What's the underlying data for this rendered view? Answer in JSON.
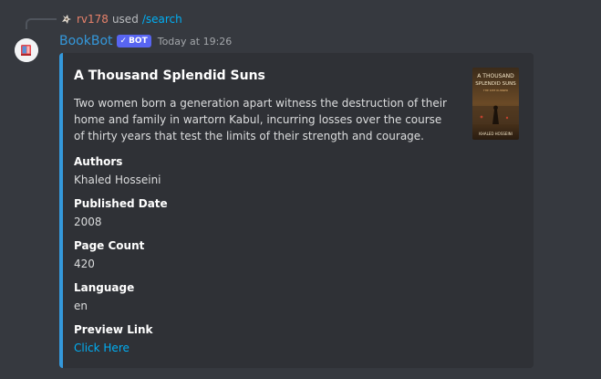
{
  "reply": {
    "username": "rv178",
    "used_text": "used",
    "command": "/search"
  },
  "author": {
    "name": "BookBot",
    "bot_tag": "BOT",
    "timestamp": "Today at 19:26"
  },
  "embed": {
    "accent_color": "#3498db",
    "title": "A Thousand Splendid Suns",
    "description": "Two women born a generation apart witness the destruction of their home and family in wartorn Kabul, incurring losses over the course of thirty years that test the limits of their strength and courage.",
    "thumbnail": {
      "title_line1": "A THOUSAND",
      "title_line2": "SPLENDID SUNS",
      "subtitle": "THE KITE RUNNER",
      "author": "KHALED HOSSEINI"
    },
    "fields": [
      {
        "name": "Authors",
        "value": "Khaled Hosseini"
      },
      {
        "name": "Published Date",
        "value": "2008"
      },
      {
        "name": "Page Count",
        "value": "420"
      },
      {
        "name": "Language",
        "value": "en"
      },
      {
        "name": "Preview Link",
        "value": "Click Here"
      }
    ]
  }
}
